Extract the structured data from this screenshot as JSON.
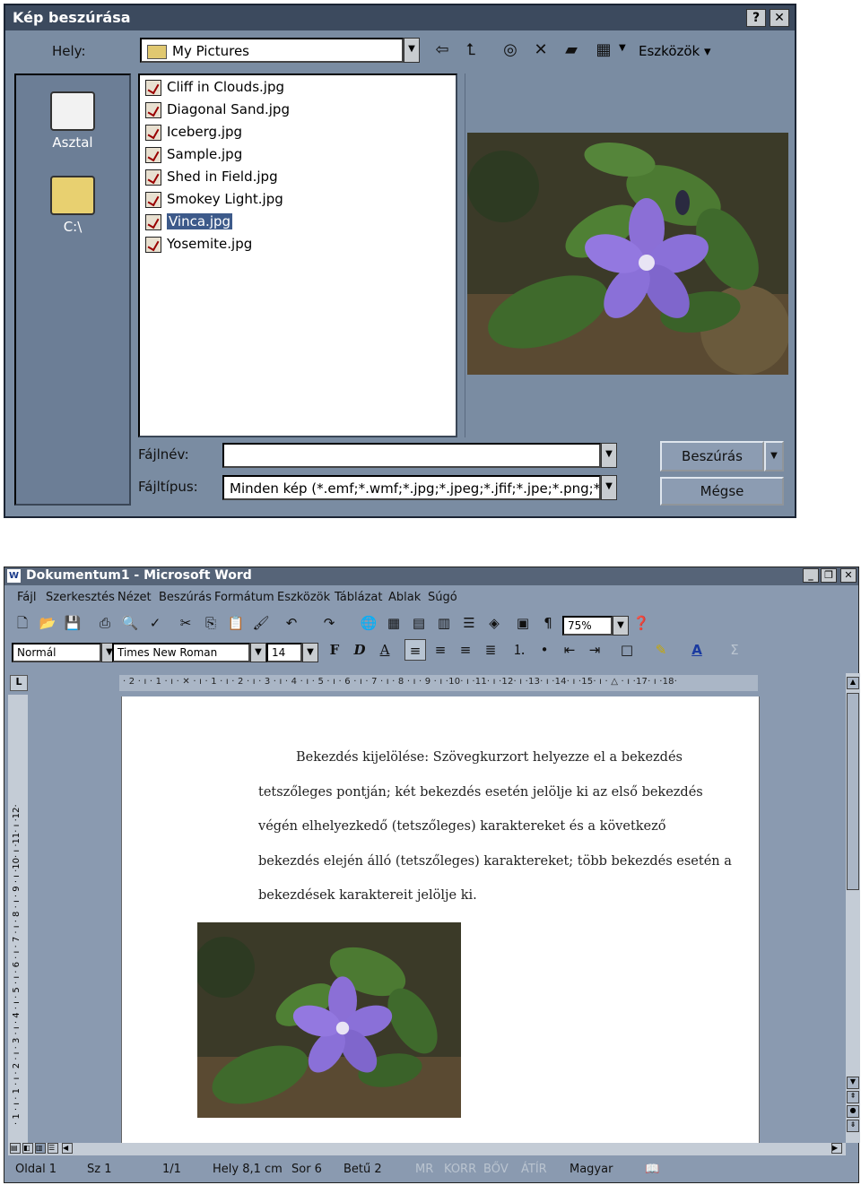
{
  "dialog": {
    "title": "Kép beszúrása",
    "help_button": "?",
    "close_button": "✕",
    "location_label": "Hely:",
    "location_value": "My Pictures",
    "tools_menu": "Eszközök",
    "places": [
      {
        "label": "Asztal",
        "icon": "desktop-icon"
      },
      {
        "label": "C:\\",
        "icon": "folder-icon"
      }
    ],
    "files": [
      {
        "name": "Cliff in Clouds.jpg",
        "selected": false
      },
      {
        "name": "Diagonal Sand.jpg",
        "selected": false
      },
      {
        "name": "Iceberg.jpg",
        "selected": false
      },
      {
        "name": "Sample.jpg",
        "selected": false
      },
      {
        "name": "Shed in Field.jpg",
        "selected": false
      },
      {
        "name": "Smokey Light.jpg",
        "selected": false
      },
      {
        "name": "Vinca.jpg",
        "selected": true
      },
      {
        "name": "Yosemite.jpg",
        "selected": false
      }
    ],
    "filename_label": "Fájlnév:",
    "filename_value": "",
    "filetype_label": "Fájltípus:",
    "filetype_value": "Minden kép (*.emf;*.wmf;*.jpg;*.jpeg;*.jfif;*.jpe;*.png;*",
    "insert_button": "Beszúrás",
    "cancel_button": "Mégse"
  },
  "word": {
    "title": "Dokumentum1 - Microsoft Word",
    "menu": [
      "Fájl",
      "Szerkesztés",
      "Nézet",
      "Beszúrás",
      "Formátum",
      "Eszközök",
      "Táblázat",
      "Ablak",
      "Súgó"
    ],
    "zoom": "75%",
    "style": "Normál",
    "font": "Times New Roman",
    "font_size": "14",
    "bold_label": "F",
    "italic_label": "D",
    "underline_label": "A",
    "ruler_text": "· 2 · ı · 1 · ı · ✕ · ı · 1 · ı · 2 · ı · 3 · ı · 4 · ı · 5 · ı · 6 · ı · 7 · ı · 8 · ı · 9 · ı ·10· ı ·11· ı ·12· ı ·13· ı ·14· ı ·15· ı · △ · ı ·17· ı ·18·",
    "vruler_text": "· 1 · ı · 1 · ı · 2 · ı · 3 · ı · 4 · ı · 5 · ı · 6 · ı · 7 · ı · 8 · ı · 9 · ı ·10· ı ·11· ı ·12·",
    "body_lines": [
      "Bekezdés kijelölése: Szövegkurzort helyezze el a bekezdés",
      "tetszőleges pontján; két bekezdés esetén jelölje ki az első bekezdés",
      "végén elhelyezkedő (tetszőleges) karaktereket és a következő",
      "bekezdés elején álló (tetszőleges) karaktereket; több bekezdés esetén a",
      "bekezdések karaktereit jelölje ki."
    ],
    "status": {
      "page": "Oldal  1",
      "section": "Sz  1",
      "pages": "1/1",
      "position": "Hely  8,1 cm",
      "line": "Sor  6",
      "column": "Betű  2",
      "rec": "MR",
      "trk": "KORR",
      "ext": "BŐV",
      "ovr": "ÁTÍR",
      "language": "Magyar"
    }
  }
}
